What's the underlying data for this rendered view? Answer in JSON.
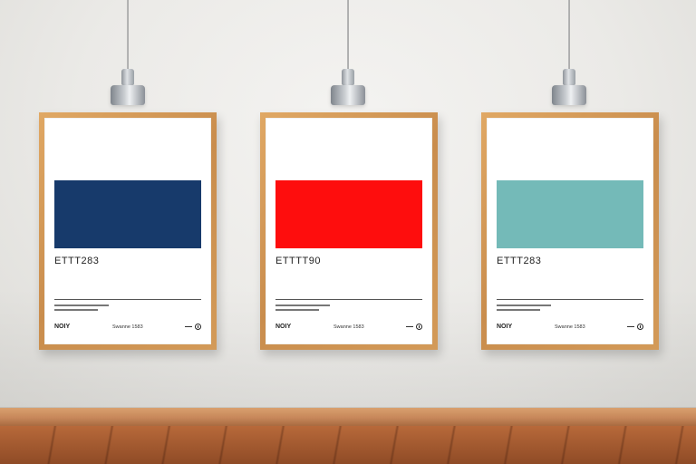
{
  "posters": [
    {
      "swatch_color": "#173a6b",
      "code": "ETTT283",
      "footer_left": "NOIY",
      "footer_mid": "Swanne 1583"
    },
    {
      "swatch_color": "#fe0d0d",
      "code": "ETTTT90",
      "footer_left": "NOIY",
      "footer_mid": "Swanne 1583"
    },
    {
      "swatch_color": "#74bab8",
      "code": "ETTT283",
      "footer_left": "NOIY",
      "footer_mid": "Swanne 1583"
    }
  ],
  "colors": {
    "frame_wood": "#d39a58",
    "floor_wood": "#a35a30"
  },
  "icons": [
    "pendant-lamp-icon",
    "poster-logo-icon"
  ]
}
